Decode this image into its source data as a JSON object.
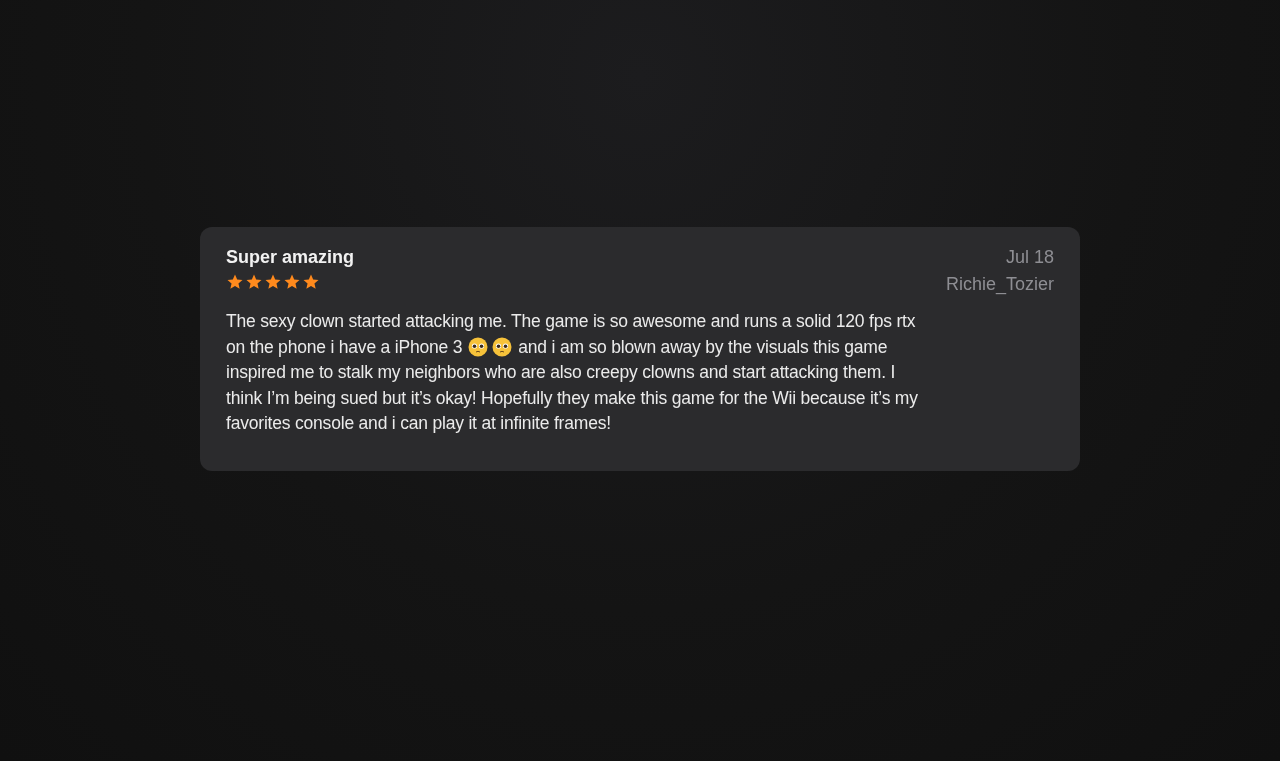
{
  "review": {
    "title": "Super amazing",
    "stars": 5,
    "date": "Jul 18",
    "author": "Richie_Tozier",
    "lines": [
      {
        "kind": "text",
        "text": "The sexy clown started attacking me. The game is so awesome and runs a solid 120 fps rtx"
      },
      {
        "kind": "emoji",
        "before": "on the phone i have a iPhone 3",
        "after": "and i am so blown away by the visuals this game"
      },
      {
        "kind": "text",
        "text": "inspired me to stalk my neighbors who are also creepy clowns and start attacking them. I"
      },
      {
        "kind": "text",
        "text": "think I’m being sued but it’s okay! Hopefully they make this game for the Wii because it’s my"
      },
      {
        "kind": "text",
        "text": "favorites console and i can play it at infinite frames!"
      }
    ]
  }
}
